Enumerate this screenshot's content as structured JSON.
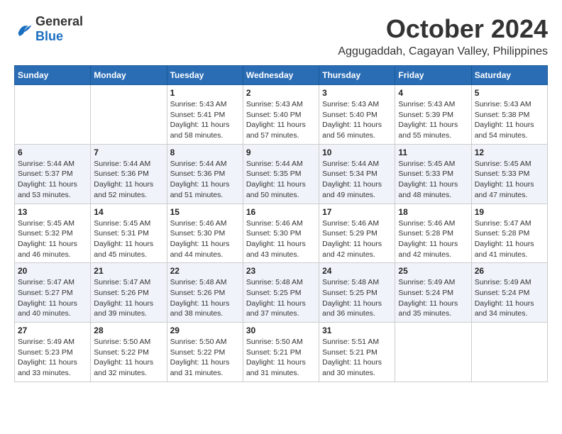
{
  "header": {
    "logo_general": "General",
    "logo_blue": "Blue",
    "month_title": "October 2024",
    "location": "Aggugaddah, Cagayan Valley, Philippines"
  },
  "calendar": {
    "days_of_week": [
      "Sunday",
      "Monday",
      "Tuesday",
      "Wednesday",
      "Thursday",
      "Friday",
      "Saturday"
    ],
    "weeks": [
      [
        {
          "day": "",
          "sunrise": "",
          "sunset": "",
          "daylight": ""
        },
        {
          "day": "",
          "sunrise": "",
          "sunset": "",
          "daylight": ""
        },
        {
          "day": "1",
          "sunrise": "Sunrise: 5:43 AM",
          "sunset": "Sunset: 5:41 PM",
          "daylight": "Daylight: 11 hours and 58 minutes."
        },
        {
          "day": "2",
          "sunrise": "Sunrise: 5:43 AM",
          "sunset": "Sunset: 5:40 PM",
          "daylight": "Daylight: 11 hours and 57 minutes."
        },
        {
          "day": "3",
          "sunrise": "Sunrise: 5:43 AM",
          "sunset": "Sunset: 5:40 PM",
          "daylight": "Daylight: 11 hours and 56 minutes."
        },
        {
          "day": "4",
          "sunrise": "Sunrise: 5:43 AM",
          "sunset": "Sunset: 5:39 PM",
          "daylight": "Daylight: 11 hours and 55 minutes."
        },
        {
          "day": "5",
          "sunrise": "Sunrise: 5:43 AM",
          "sunset": "Sunset: 5:38 PM",
          "daylight": "Daylight: 11 hours and 54 minutes."
        }
      ],
      [
        {
          "day": "6",
          "sunrise": "Sunrise: 5:44 AM",
          "sunset": "Sunset: 5:37 PM",
          "daylight": "Daylight: 11 hours and 53 minutes."
        },
        {
          "day": "7",
          "sunrise": "Sunrise: 5:44 AM",
          "sunset": "Sunset: 5:36 PM",
          "daylight": "Daylight: 11 hours and 52 minutes."
        },
        {
          "day": "8",
          "sunrise": "Sunrise: 5:44 AM",
          "sunset": "Sunset: 5:36 PM",
          "daylight": "Daylight: 11 hours and 51 minutes."
        },
        {
          "day": "9",
          "sunrise": "Sunrise: 5:44 AM",
          "sunset": "Sunset: 5:35 PM",
          "daylight": "Daylight: 11 hours and 50 minutes."
        },
        {
          "day": "10",
          "sunrise": "Sunrise: 5:44 AM",
          "sunset": "Sunset: 5:34 PM",
          "daylight": "Daylight: 11 hours and 49 minutes."
        },
        {
          "day": "11",
          "sunrise": "Sunrise: 5:45 AM",
          "sunset": "Sunset: 5:33 PM",
          "daylight": "Daylight: 11 hours and 48 minutes."
        },
        {
          "day": "12",
          "sunrise": "Sunrise: 5:45 AM",
          "sunset": "Sunset: 5:33 PM",
          "daylight": "Daylight: 11 hours and 47 minutes."
        }
      ],
      [
        {
          "day": "13",
          "sunrise": "Sunrise: 5:45 AM",
          "sunset": "Sunset: 5:32 PM",
          "daylight": "Daylight: 11 hours and 46 minutes."
        },
        {
          "day": "14",
          "sunrise": "Sunrise: 5:45 AM",
          "sunset": "Sunset: 5:31 PM",
          "daylight": "Daylight: 11 hours and 45 minutes."
        },
        {
          "day": "15",
          "sunrise": "Sunrise: 5:46 AM",
          "sunset": "Sunset: 5:30 PM",
          "daylight": "Daylight: 11 hours and 44 minutes."
        },
        {
          "day": "16",
          "sunrise": "Sunrise: 5:46 AM",
          "sunset": "Sunset: 5:30 PM",
          "daylight": "Daylight: 11 hours and 43 minutes."
        },
        {
          "day": "17",
          "sunrise": "Sunrise: 5:46 AM",
          "sunset": "Sunset: 5:29 PM",
          "daylight": "Daylight: 11 hours and 42 minutes."
        },
        {
          "day": "18",
          "sunrise": "Sunrise: 5:46 AM",
          "sunset": "Sunset: 5:28 PM",
          "daylight": "Daylight: 11 hours and 42 minutes."
        },
        {
          "day": "19",
          "sunrise": "Sunrise: 5:47 AM",
          "sunset": "Sunset: 5:28 PM",
          "daylight": "Daylight: 11 hours and 41 minutes."
        }
      ],
      [
        {
          "day": "20",
          "sunrise": "Sunrise: 5:47 AM",
          "sunset": "Sunset: 5:27 PM",
          "daylight": "Daylight: 11 hours and 40 minutes."
        },
        {
          "day": "21",
          "sunrise": "Sunrise: 5:47 AM",
          "sunset": "Sunset: 5:26 PM",
          "daylight": "Daylight: 11 hours and 39 minutes."
        },
        {
          "day": "22",
          "sunrise": "Sunrise: 5:48 AM",
          "sunset": "Sunset: 5:26 PM",
          "daylight": "Daylight: 11 hours and 38 minutes."
        },
        {
          "day": "23",
          "sunrise": "Sunrise: 5:48 AM",
          "sunset": "Sunset: 5:25 PM",
          "daylight": "Daylight: 11 hours and 37 minutes."
        },
        {
          "day": "24",
          "sunrise": "Sunrise: 5:48 AM",
          "sunset": "Sunset: 5:25 PM",
          "daylight": "Daylight: 11 hours and 36 minutes."
        },
        {
          "day": "25",
          "sunrise": "Sunrise: 5:49 AM",
          "sunset": "Sunset: 5:24 PM",
          "daylight": "Daylight: 11 hours and 35 minutes."
        },
        {
          "day": "26",
          "sunrise": "Sunrise: 5:49 AM",
          "sunset": "Sunset: 5:24 PM",
          "daylight": "Daylight: 11 hours and 34 minutes."
        }
      ],
      [
        {
          "day": "27",
          "sunrise": "Sunrise: 5:49 AM",
          "sunset": "Sunset: 5:23 PM",
          "daylight": "Daylight: 11 hours and 33 minutes."
        },
        {
          "day": "28",
          "sunrise": "Sunrise: 5:50 AM",
          "sunset": "Sunset: 5:22 PM",
          "daylight": "Daylight: 11 hours and 32 minutes."
        },
        {
          "day": "29",
          "sunrise": "Sunrise: 5:50 AM",
          "sunset": "Sunset: 5:22 PM",
          "daylight": "Daylight: 11 hours and 31 minutes."
        },
        {
          "day": "30",
          "sunrise": "Sunrise: 5:50 AM",
          "sunset": "Sunset: 5:21 PM",
          "daylight": "Daylight: 11 hours and 31 minutes."
        },
        {
          "day": "31",
          "sunrise": "Sunrise: 5:51 AM",
          "sunset": "Sunset: 5:21 PM",
          "daylight": "Daylight: 11 hours and 30 minutes."
        },
        {
          "day": "",
          "sunrise": "",
          "sunset": "",
          "daylight": ""
        },
        {
          "day": "",
          "sunrise": "",
          "sunset": "",
          "daylight": ""
        }
      ]
    ]
  }
}
